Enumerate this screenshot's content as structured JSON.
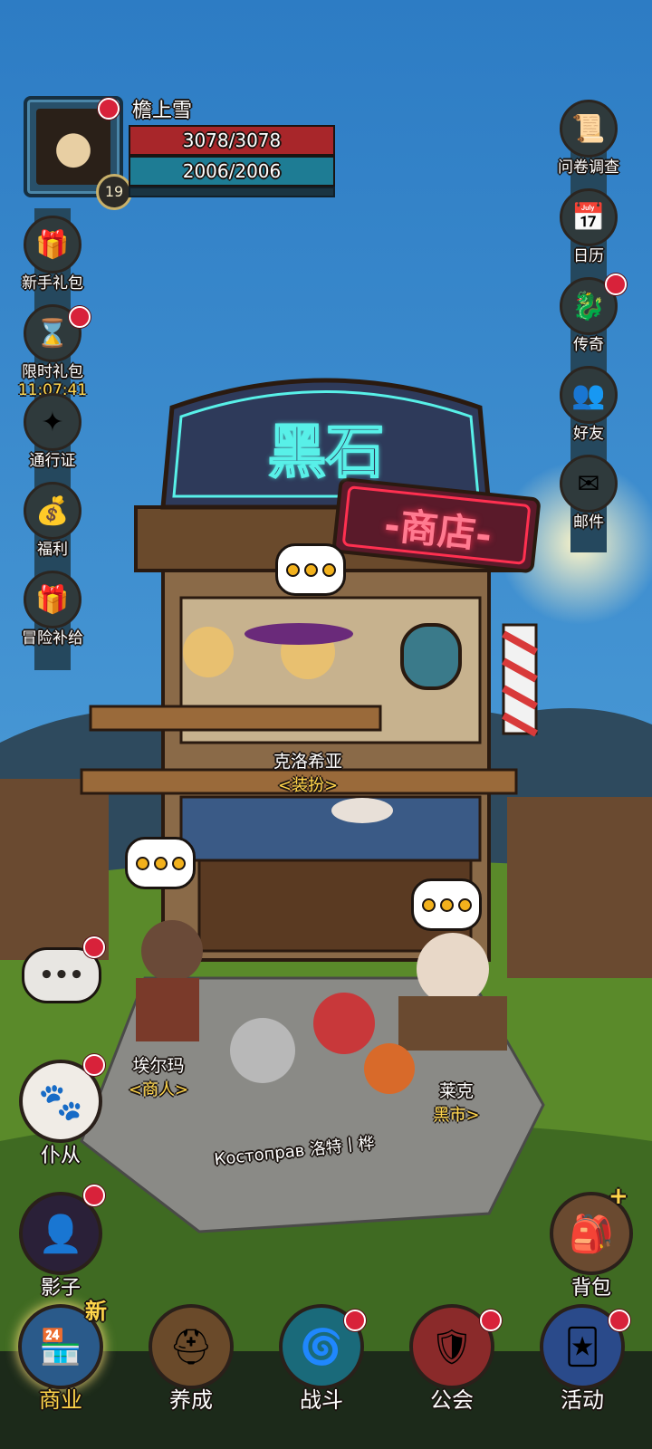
{
  "player": {
    "name": "檐上雪",
    "level": "19",
    "hp": "3078/3078",
    "mp": "2006/2006"
  },
  "left_menu": [
    {
      "label": "新手礼包",
      "icon": "gift-box-icon",
      "glyph": "🎁"
    },
    {
      "label": "限时礼包",
      "icon": "hourglass-icon",
      "glyph": "⌛",
      "timer": "11:07:41"
    },
    {
      "label": "通行证",
      "icon": "star-badge-icon",
      "glyph": "✦"
    },
    {
      "label": "福利",
      "icon": "gold-pile-icon",
      "glyph": "💰"
    },
    {
      "label": "冒险补给",
      "icon": "supply-box-icon",
      "glyph": "🎁"
    }
  ],
  "right_menu": [
    {
      "label": "问卷调查",
      "icon": "survey-scroll-icon",
      "glyph": "📜"
    },
    {
      "label": "日历",
      "icon": "calendar-icon",
      "glyph": "📅"
    },
    {
      "label": "传奇",
      "icon": "dragon-icon",
      "glyph": "🐉"
    },
    {
      "label": "好友",
      "icon": "friends-icon",
      "glyph": "👥"
    },
    {
      "label": "邮件",
      "icon": "mail-icon",
      "glyph": "✉"
    }
  ],
  "shop": {
    "sign_main": "黑石",
    "sign_neon": "-商店-"
  },
  "npcs": [
    {
      "name": "克洛希亚",
      "role": "<装扮>"
    },
    {
      "name": "埃尔玛",
      "role": "<商人>"
    },
    {
      "name": "莱克",
      "role": "黑市>"
    }
  ],
  "party_label": "Костоправ 洛特丨桦",
  "side_buttons": {
    "chat_glyph": "•••",
    "pet": "仆从",
    "shadow": "影子",
    "bag": "背包"
  },
  "bottom_nav": [
    {
      "label": "商业",
      "icon": "shop-icon",
      "glyph": "🏪",
      "badge": "新"
    },
    {
      "label": "养成",
      "icon": "helmet-icon",
      "glyph": "⛑"
    },
    {
      "label": "战斗",
      "icon": "portal-icon",
      "glyph": "🌀"
    },
    {
      "label": "公会",
      "icon": "guild-banner-icon",
      "glyph": "🛡"
    },
    {
      "label": "活动",
      "icon": "cards-icon",
      "glyph": "🃏"
    }
  ],
  "colors": {
    "sky": "#3a86c8",
    "hp": "#a8262a",
    "mp": "#1e7c94",
    "neon_red": "#ff3050",
    "neon_cyan": "#58f0e8",
    "alert": "#d8223a"
  }
}
